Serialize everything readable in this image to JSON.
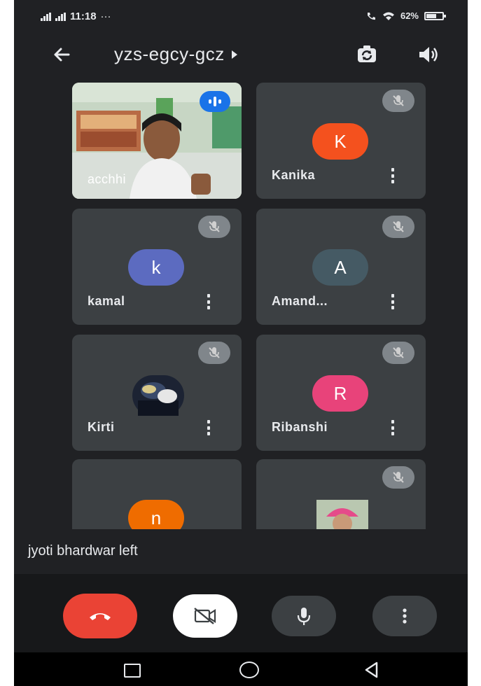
{
  "status_bar": {
    "time": "11:18",
    "extra_icons": "···",
    "battery": "62%",
    "battery_level": 0.62
  },
  "app_bar": {
    "meeting_code": "yzs-egcy-gcz"
  },
  "participants": [
    {
      "name": "acchhi",
      "initial": "",
      "avatar_color": "",
      "type": "video",
      "muted": false,
      "speaking": true
    },
    {
      "name": "Kanika",
      "initial": "K",
      "avatar_color": "#f4511e",
      "type": "initial",
      "muted": true
    },
    {
      "name": "kamal",
      "initial": "k",
      "avatar_color": "#5c6bc0",
      "type": "initial",
      "muted": true
    },
    {
      "name": "Amand...",
      "initial": "A",
      "avatar_color": "#455a64",
      "type": "initial",
      "muted": true
    },
    {
      "name": "Kirti",
      "initial": "",
      "avatar_color": "#1c2333",
      "type": "photo",
      "muted": true
    },
    {
      "name": "Ribanshi",
      "initial": "R",
      "avatar_color": "#e8437a",
      "type": "initial",
      "muted": true
    },
    {
      "name": "",
      "initial": "n",
      "avatar_color": "#ef6c00",
      "type": "initial",
      "muted": false
    },
    {
      "name": "",
      "initial": "",
      "avatar_color": "#c9b8a8",
      "type": "photo",
      "muted": true
    }
  ],
  "toast": {
    "message": "jyoti bhardwar left"
  },
  "controls": {
    "end_call_color": "#ea4335",
    "camera_bg": "#ffffff",
    "button_bg": "#3c4043"
  },
  "colors": {
    "background": "#202124",
    "tile": "#3c4043",
    "speaking_indicator": "#1a73e8"
  }
}
